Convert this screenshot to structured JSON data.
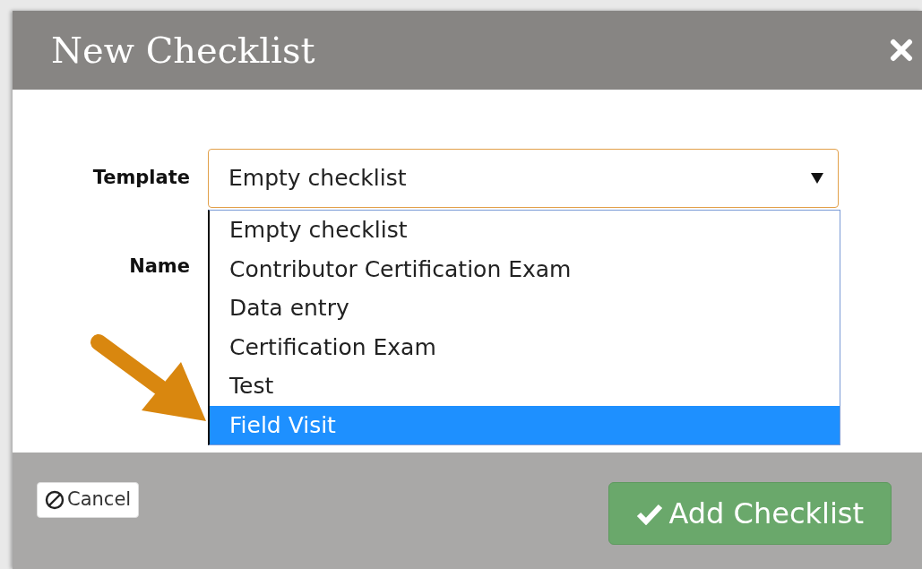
{
  "dialog": {
    "title": "New Checklist"
  },
  "fields": [
    {
      "label": "Template",
      "value": "Empty checklist"
    },
    {
      "label": "Name"
    }
  ],
  "dropdown": {
    "options": [
      {
        "label": "Empty checklist",
        "selected": false
      },
      {
        "label": "Contributor Certification Exam",
        "selected": false
      },
      {
        "label": "Data entry",
        "selected": false
      },
      {
        "label": "Certification Exam",
        "selected": false
      },
      {
        "label": "Test",
        "selected": false
      },
      {
        "label": "Field Visit",
        "selected": true
      }
    ]
  },
  "buttons": [
    {
      "kind": "cancel",
      "label": "Cancel"
    },
    {
      "kind": "submit",
      "label": "Add Checklist"
    }
  ]
}
